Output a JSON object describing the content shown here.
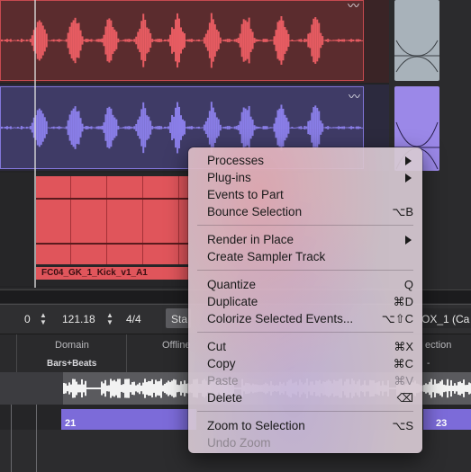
{
  "arrange": {
    "kick_event_label": "FC04_GK_1_Kick_v1_A1"
  },
  "toolbar": {
    "field1_value": "0",
    "field2_value": "121.18",
    "signature": "4/4",
    "state_button": "Sta",
    "right_field": "OX_1 (Ca"
  },
  "editor": {
    "domain_label": "Domain",
    "domain_value": "Bars+Beats",
    "offline_label": "Offline",
    "selection_label": "ection",
    "selection_value": "-",
    "ruler": {
      "bar21": "21",
      "bar23": "23"
    }
  },
  "context_menu": {
    "groups": [
      [
        {
          "label": "Processes",
          "shortcut": "",
          "submenu": true,
          "enabled": true
        },
        {
          "label": "Plug-ins",
          "shortcut": "",
          "submenu": true,
          "enabled": true
        },
        {
          "label": "Events to Part",
          "shortcut": "",
          "submenu": false,
          "enabled": true
        },
        {
          "label": "Bounce Selection",
          "shortcut": "⌥B",
          "submenu": false,
          "enabled": true
        }
      ],
      [
        {
          "label": "Render in Place",
          "shortcut": "",
          "submenu": true,
          "enabled": true
        },
        {
          "label": "Create Sampler Track",
          "shortcut": "",
          "submenu": false,
          "enabled": true
        }
      ],
      [
        {
          "label": "Quantize",
          "shortcut": "Q",
          "submenu": false,
          "enabled": true
        },
        {
          "label": "Duplicate",
          "shortcut": "⌘D",
          "submenu": false,
          "enabled": true
        },
        {
          "label": "Colorize Selected Events...",
          "shortcut": "⌥⇧C",
          "submenu": false,
          "enabled": true
        }
      ],
      [
        {
          "label": "Cut",
          "shortcut": "⌘X",
          "submenu": false,
          "enabled": true
        },
        {
          "label": "Copy",
          "shortcut": "⌘C",
          "submenu": false,
          "enabled": true
        },
        {
          "label": "Paste",
          "shortcut": "⌘V",
          "submenu": false,
          "enabled": false
        },
        {
          "label": "Delete",
          "shortcut": "⌫",
          "submenu": false,
          "enabled": true
        }
      ],
      [
        {
          "label": "Zoom to Selection",
          "shortcut": "⌥S",
          "submenu": false,
          "enabled": true
        },
        {
          "label": "Undo Zoom",
          "shortcut": "",
          "submenu": false,
          "enabled": false
        }
      ]
    ]
  },
  "colors": {
    "red_event": "#e0555b",
    "purple_event": "#8276d9",
    "ruler_purple": "#7c6bd9"
  }
}
